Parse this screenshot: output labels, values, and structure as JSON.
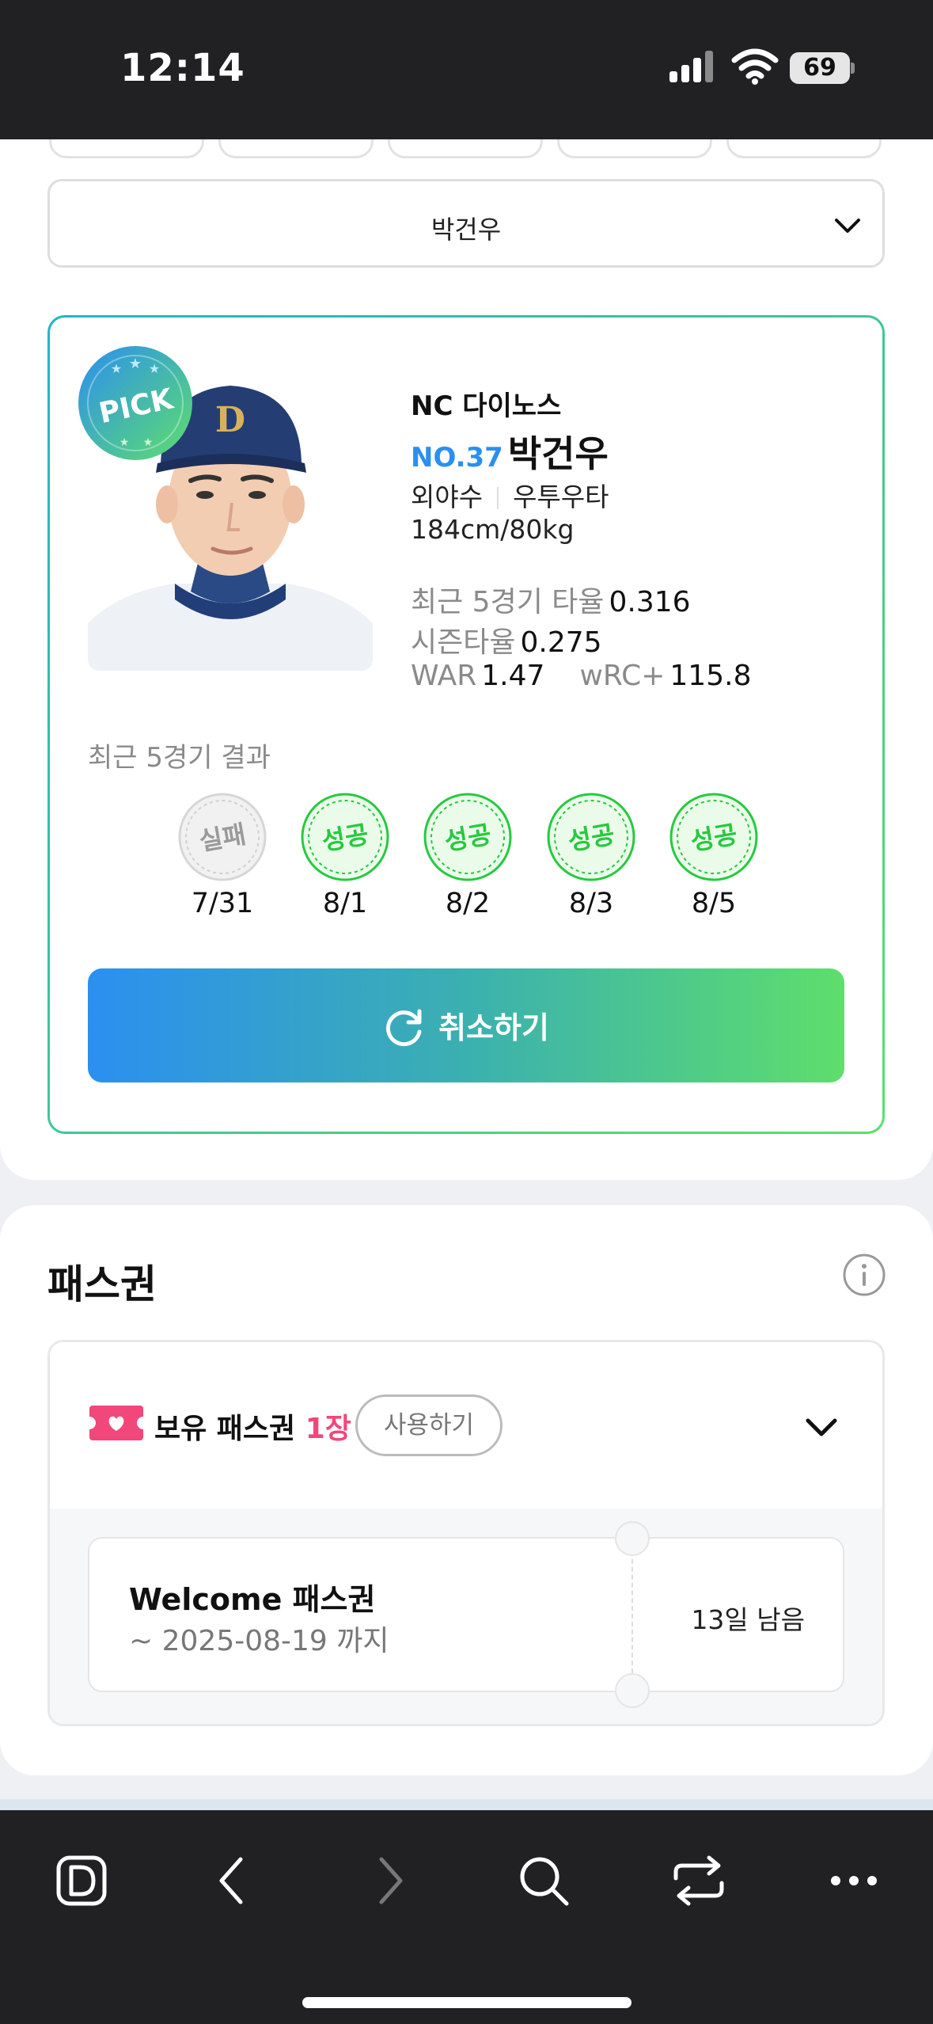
{
  "status_bar": {
    "time": "12:14",
    "battery": "69"
  },
  "player_select": {
    "value": "박건우"
  },
  "player_card": {
    "badge": "PICK",
    "team": "NC 다이노스",
    "number": "NO.37",
    "name": "박건우",
    "position": "외야수",
    "bats_throws": "우투우타",
    "body": "184cm/80kg",
    "stats": {
      "recent5_label": "최근 5경기 타율",
      "recent5_value": "0.316",
      "season_label": "시즌타율",
      "season_value": "0.275",
      "war_label": "WAR",
      "war_value": "1.47",
      "wrc_label": "wRC+",
      "wrc_value": "115.8"
    },
    "recent_title": "최근 5경기 결과",
    "games": [
      {
        "result": "실패",
        "date": "7/31",
        "status": "fail"
      },
      {
        "result": "성공",
        "date": "8/1",
        "status": "success"
      },
      {
        "result": "성공",
        "date": "8/2",
        "status": "success"
      },
      {
        "result": "성공",
        "date": "8/3",
        "status": "success"
      },
      {
        "result": "성공",
        "date": "8/5",
        "status": "success"
      }
    ],
    "cancel_label": "취소하기"
  },
  "pass": {
    "title": "패스권",
    "owned_label": "보유 패스권",
    "owned_count": "1장",
    "use_label": "사용하기",
    "ticket": {
      "name": "Welcome 패스권",
      "expiry": "~ 2025-08-19 까지",
      "remaining": "13일 남음"
    }
  },
  "colors": {
    "accent_blue": "#2b8ff0",
    "accent_green": "#5ede6c",
    "success": "#27c93f",
    "pink": "#f2477a",
    "dark_bar": "#212124"
  },
  "icons": [
    "signal-icon",
    "wifi-icon",
    "battery-icon",
    "chevron-down-icon",
    "pick-badge-icon",
    "refresh-icon",
    "info-icon",
    "ticket-icon",
    "d-logo-icon",
    "back-icon",
    "forward-icon",
    "search-icon",
    "tabs-switch-icon",
    "more-icon"
  ]
}
